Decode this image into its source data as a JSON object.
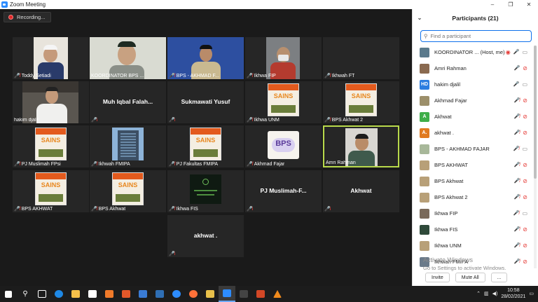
{
  "window": {
    "title": "Zoom Meeting",
    "minimize": "–",
    "maximize": "❐",
    "close": "✕"
  },
  "recording": {
    "label": "Recording..."
  },
  "tiles": [
    {
      "id": "toddy",
      "name": "Toddy Setiadi",
      "type": "video"
    },
    {
      "id": "koordinator",
      "name": "KOORDINATOR BPS ...",
      "type": "video"
    },
    {
      "id": "bps-akhmad",
      "name": "BPS - AKHMAD F...",
      "type": "video"
    },
    {
      "id": "ikhwa-fip",
      "name": "Ikhwa FIP",
      "type": "video"
    },
    {
      "id": "ikhwah-ft",
      "name": "Ikhwah FT",
      "type": "blank"
    },
    {
      "id": "hakim",
      "name": "hakim djalil",
      "type": "video"
    },
    {
      "id": "muh-iqbal",
      "name": "Muh Iqbal Falah...",
      "type": "name"
    },
    {
      "id": "sukmawati",
      "name": "Sukmawati Yusuf",
      "type": "name"
    },
    {
      "id": "ikhwa-unm",
      "name": "Ikhwa UNM",
      "type": "poster"
    },
    {
      "id": "bps-akhwat-2",
      "name": "BPS Akhwat 2",
      "type": "poster"
    },
    {
      "id": "pj-muslimah-fpsi",
      "name": "PJ Muslimah FPsi",
      "type": "poster"
    },
    {
      "id": "ikhwah-fmipa",
      "name": "Ikhwah FMIPA",
      "type": "building"
    },
    {
      "id": "pj-fakultas-fmipa",
      "name": "PJ Fakultas FMIPA",
      "type": "poster"
    },
    {
      "id": "akhmad-fajar",
      "name": "Akhmad Fajar",
      "type": "logo"
    },
    {
      "id": "amri-rahman",
      "name": "Amri Rahman",
      "type": "video"
    },
    {
      "id": "bps-akhwat",
      "name": "BPS AKHWAT",
      "type": "poster"
    },
    {
      "id": "bps-akhwat-b",
      "name": "BPS Akhwat",
      "type": "poster"
    },
    {
      "id": "ikhwa-fis",
      "name": "Ikhwa FIS",
      "type": "emblem"
    },
    {
      "id": "pj-muslimah-f",
      "name": "PJ Muslimah-F...",
      "type": "name"
    },
    {
      "id": "akhwat",
      "name": "Akhwat",
      "type": "name"
    },
    {
      "id": "akhwat-dot",
      "name": "akhwat .",
      "type": "name"
    }
  ],
  "poster_word": "SAINS",
  "logo_text": "BPS",
  "participants": {
    "title": "Participants (21)",
    "search_placeholder": "Find a participant",
    "list": [
      {
        "name": "KOORDINATOR ...",
        "role": "(Host, me)",
        "avatar_color": "#5b7a8c",
        "initials": "",
        "mic": "on",
        "cam": "on",
        "rec": true
      },
      {
        "name": "Amri Rahman",
        "role": "",
        "avatar_color": "#8a6a50",
        "initials": "",
        "mic": "on",
        "cam": "off"
      },
      {
        "name": "hakim djalil",
        "role": "",
        "avatar_color": "#2b7de0",
        "initials": "HD",
        "mic": "on",
        "cam": "on"
      },
      {
        "name": "Akhmad Fajar",
        "role": "",
        "avatar_color": "#9c8f6a",
        "initials": "",
        "mic": "off",
        "cam": "off"
      },
      {
        "name": "Akhwat",
        "role": "",
        "avatar_color": "#3fae49",
        "initials": "A",
        "mic": "off",
        "cam": "off"
      },
      {
        "name": "akhwat .",
        "role": "",
        "avatar_color": "#e07a1f",
        "initials": "A.",
        "mic": "off",
        "cam": "off"
      },
      {
        "name": "BPS - AKHMAD FAJAR",
        "role": "",
        "avatar_color": "#a8b89a",
        "initials": "",
        "mic": "off",
        "cam": "on"
      },
      {
        "name": "BPS AKHWAT",
        "role": "",
        "avatar_color": "#b8a078",
        "initials": "",
        "mic": "off",
        "cam": "off"
      },
      {
        "name": "BPS Akhwat",
        "role": "",
        "avatar_color": "#b8a078",
        "initials": "",
        "mic": "off",
        "cam": "off"
      },
      {
        "name": "BPS Akhwat 2",
        "role": "",
        "avatar_color": "#b8a078",
        "initials": "",
        "mic": "off",
        "cam": "off"
      },
      {
        "name": "Ikhwa FIP",
        "role": "",
        "avatar_color": "#7a6a5a",
        "initials": "",
        "mic": "off",
        "cam": "on"
      },
      {
        "name": "Ikhwa FIS",
        "role": "",
        "avatar_color": "#2f4a3a",
        "initials": "",
        "mic": "off",
        "cam": "off"
      },
      {
        "name": "Ikhwa UNM",
        "role": "",
        "avatar_color": "#b8a078",
        "initials": "",
        "mic": "off",
        "cam": "off"
      },
      {
        "name": "Ikhwah FMIPA",
        "role": "",
        "avatar_color": "#6a7a8a",
        "initials": "",
        "mic": "off",
        "cam": "off"
      }
    ],
    "invite": "Invite",
    "mute_all": "Mute All",
    "more": "..."
  },
  "watermark": {
    "line1": "Activate Windows",
    "line2": "Go to Settings to activate Windows."
  },
  "taskbar": {
    "time": "10:58",
    "date": "28/02/2021"
  },
  "colors": {
    "accent": "#0e71eb",
    "active_speaker": "#b8d94b",
    "mic_off": "#e53935",
    "recording": "#e02828"
  }
}
